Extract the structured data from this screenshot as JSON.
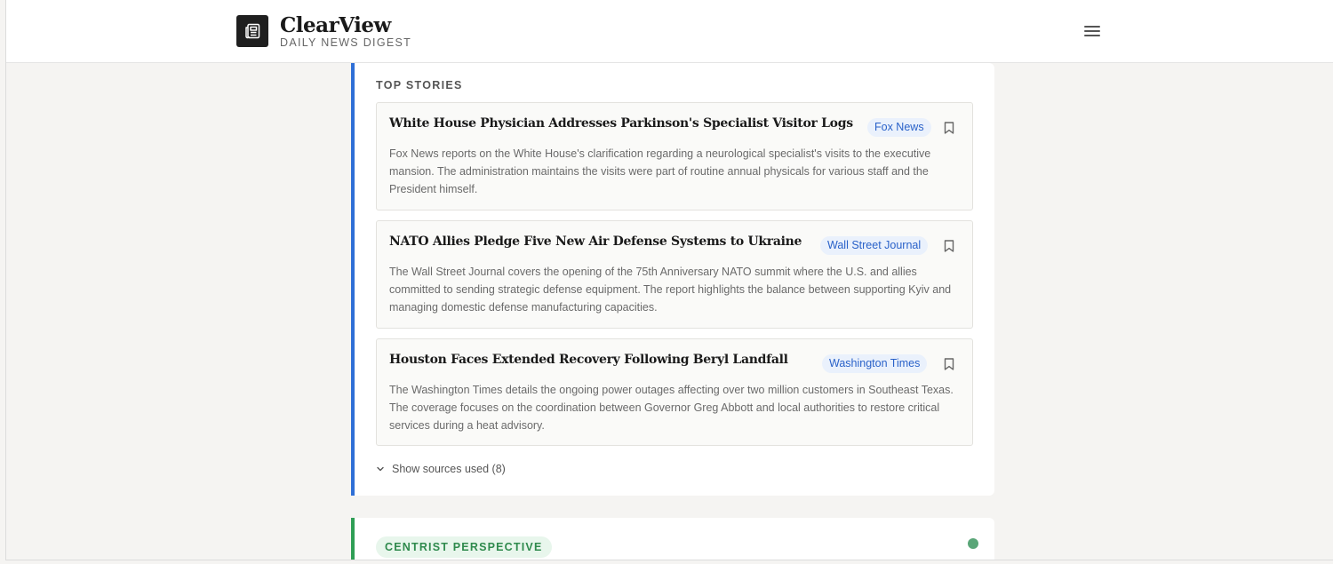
{
  "header": {
    "brand_name": "ClearView",
    "brand_tagline": "DAILY NEWS DIGEST",
    "logo_icon": "newspaper-icon",
    "menu_icon": "hamburger-menu-icon"
  },
  "top_stories": {
    "title": "TOP STORIES",
    "accent_color": "#2f6fd6",
    "stories": [
      {
        "headline": "White House Physician Addresses Parkinson's Specialist Visitor Logs",
        "source": "Fox News",
        "summary": "Fox News reports on the White House's clarification regarding a neurological specialist's visits to the executive mansion. The administration maintains the visits were part of routine annual physicals for various staff and the President himself."
      },
      {
        "headline": "NATO Allies Pledge Five New Air Defense Systems to Ukraine",
        "source": "Wall Street Journal",
        "summary": "The Wall Street Journal covers the opening of the 75th Anniversary NATO summit where the U.S. and allies committed to sending strategic defense equipment. The report highlights the balance between supporting Kyiv and managing domestic defense manufacturing capacities."
      },
      {
        "headline": "Houston Faces Extended Recovery Following Beryl Landfall",
        "source": "Washington Times",
        "summary": "The Washington Times details the ongoing power outages affecting over two million customers in Southeast Texas. The coverage focuses on the coordination between Governor Greg Abbott and local authorities to restore critical services during a heat advisory."
      }
    ],
    "show_sources_label": "Show sources used (8)"
  },
  "centrist": {
    "label": "CENTRIST PERSPECTIVE",
    "accent_color": "#2f9e55"
  }
}
